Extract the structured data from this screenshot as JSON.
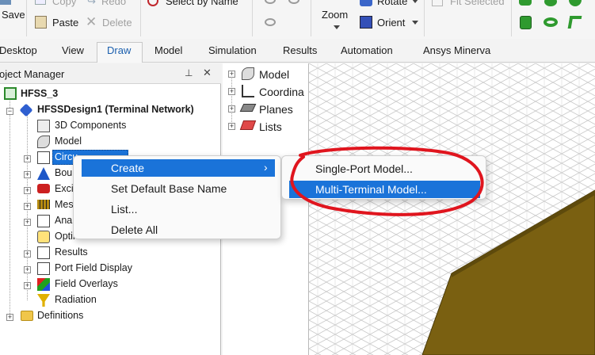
{
  "ribbon": {
    "save": "Save",
    "copy": "Copy",
    "paste": "Paste",
    "redo": "Redo",
    "delete": "Delete",
    "select_by_name": "Select by Name",
    "zoom": "Zoom",
    "rotate": "Rotate",
    "orient": "Orient",
    "fit_selected": "Fit Selected"
  },
  "tabs": [
    "Desktop",
    "View",
    "Draw",
    "Model",
    "Simulation",
    "Results",
    "Automation",
    "Ansys Minerva"
  ],
  "active_tab": "Draw",
  "project_manager": {
    "title": "oject Manager",
    "pin": "⊥",
    "close": "✕",
    "project": "HFSS_3",
    "design": "HFSSDesign1 (Terminal Network)",
    "items": [
      "3D Components",
      "Model",
      "Circu",
      "Boun",
      "Excit",
      "Mesh",
      "Anal",
      "Optir",
      "Results",
      "Port Field Display",
      "Field Overlays",
      "Radiation"
    ],
    "definitions": "Definitions"
  },
  "model_tree": [
    "Model",
    "Coordina",
    "Planes",
    "Lists"
  ],
  "context_menu": {
    "items": [
      "Create",
      "Set Default Base Name",
      "List...",
      "Delete All"
    ],
    "submenu_arrow": "›"
  },
  "submenu": {
    "items": [
      "Single-Port Model...",
      "Multi-Terminal Model..."
    ]
  },
  "colors": {
    "highlight": "#1a73d9",
    "annotation": "#e0151e",
    "solid": "#7a6011",
    "tab_active": "#1b5fae"
  }
}
